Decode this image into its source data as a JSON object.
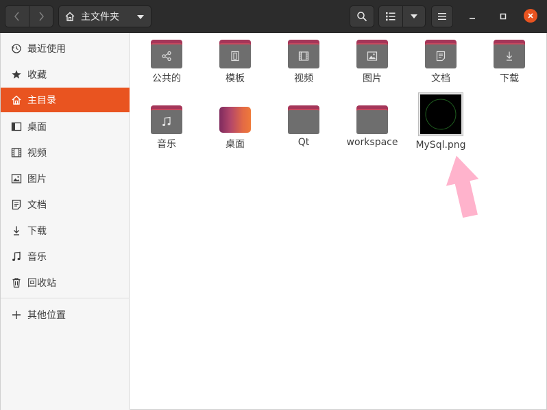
{
  "header": {
    "path_label": "主文件夹",
    "icons": {
      "back": "chevron-left-icon",
      "forward": "chevron-right-icon",
      "home": "home-icon",
      "search": "search-icon",
      "list_view": "list-view-icon",
      "menu": "hamburger-menu-icon"
    }
  },
  "sidebar": {
    "items": [
      {
        "label": "最近使用",
        "icon": "clock-icon"
      },
      {
        "label": "收藏",
        "icon": "star-icon"
      },
      {
        "label": "主目录",
        "icon": "home-icon",
        "active": true
      },
      {
        "label": "桌面",
        "icon": "desktop-icon"
      },
      {
        "label": "视频",
        "icon": "film-icon"
      },
      {
        "label": "图片",
        "icon": "image-icon"
      },
      {
        "label": "文档",
        "icon": "document-icon"
      },
      {
        "label": "下载",
        "icon": "download-icon"
      },
      {
        "label": "音乐",
        "icon": "music-icon"
      },
      {
        "label": "回收站",
        "icon": "trash-icon"
      }
    ],
    "other_locations": {
      "label": "其他位置",
      "icon": "plus-icon"
    }
  },
  "files": [
    {
      "name": "公共的",
      "type": "folder",
      "icon": "share-icon"
    },
    {
      "name": "模板",
      "type": "folder",
      "icon": "template-icon"
    },
    {
      "name": "视频",
      "type": "folder",
      "icon": "film-icon"
    },
    {
      "name": "图片",
      "type": "folder",
      "icon": "image-icon"
    },
    {
      "name": "文档",
      "type": "folder",
      "icon": "document-icon"
    },
    {
      "name": "下载",
      "type": "folder",
      "icon": "download-icon"
    },
    {
      "name": "音乐",
      "type": "folder",
      "icon": "music-icon"
    },
    {
      "name": "桌面",
      "type": "folder",
      "icon": "desktop-icon"
    },
    {
      "name": "Qt",
      "type": "folder",
      "icon": "folder-icon"
    },
    {
      "name": "workspace",
      "type": "folder",
      "icon": "folder-icon"
    },
    {
      "name": "MySql.png",
      "type": "image",
      "icon": "image-thumbnail"
    }
  ],
  "colors": {
    "accent": "#e95420",
    "header_bg": "#2c2c2c",
    "folder_body": "#6e6e6e",
    "folder_tab": "#a53659",
    "annotation_arrow": "#ffb3cc"
  }
}
